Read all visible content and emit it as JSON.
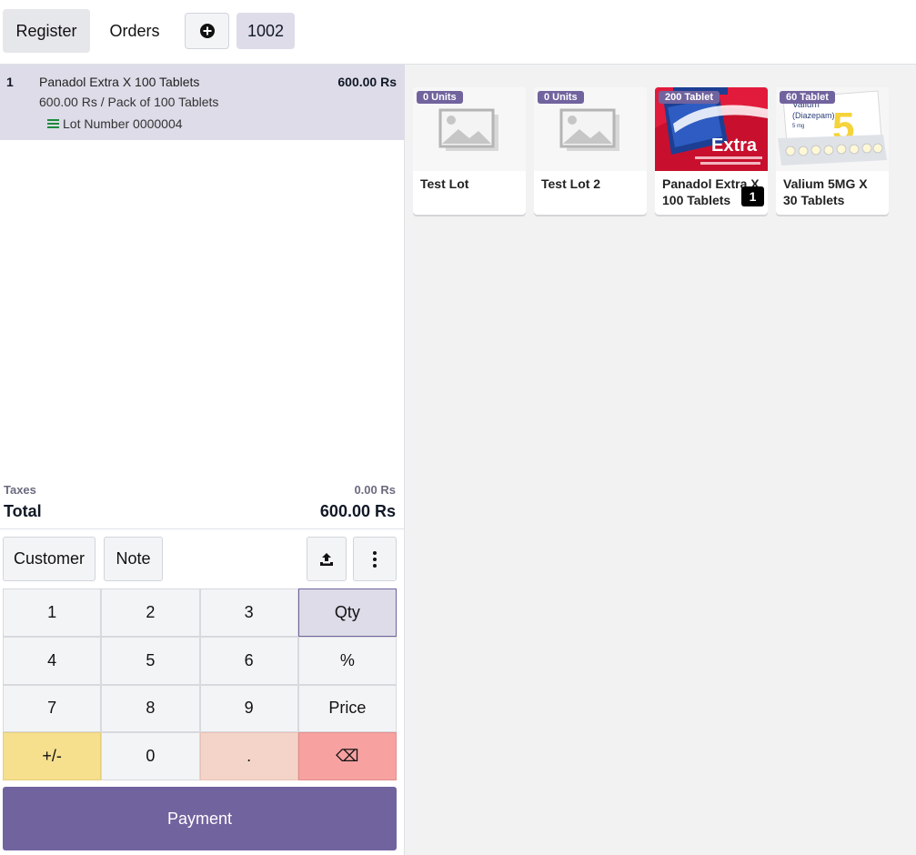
{
  "navbar": {
    "register_label": "Register",
    "orders_label": "Orders",
    "add_order_icon": "plus-circle-icon",
    "order_number": "1002"
  },
  "orderline": {
    "qty": "1",
    "product_name": "Panadol Extra X 100 Tablets",
    "price": "600.00 Rs",
    "unit_info": "600.00 Rs / Pack of 100 Tablets",
    "lot": "Lot Number 0000004"
  },
  "summary": {
    "taxes_label": "Taxes",
    "taxes_value": "0.00 Rs",
    "total_label": "Total",
    "total_value": "600.00 Rs"
  },
  "controls": {
    "customer_label": "Customer",
    "note_label": "Note",
    "upload_icon": "upload-icon",
    "more_icon": "kebab-menu-icon"
  },
  "numpad": {
    "keys": [
      "1",
      "2",
      "3",
      "Qty",
      "4",
      "5",
      "6",
      "%",
      "7",
      "8",
      "9",
      "Price",
      "+/-",
      "0",
      ".",
      "⌫"
    ]
  },
  "payment_label": "Payment",
  "products": [
    {
      "name": "Test Lot",
      "badge": "0 Units",
      "image": "placeholder"
    },
    {
      "name": "Test Lot 2",
      "badge": "0 Units",
      "image": "placeholder"
    },
    {
      "name": "Panadol Extra X 100 Tablets",
      "badge": "200 Tablet",
      "image": "panadol",
      "cart_qty": "1"
    },
    {
      "name": "Valium 5MG X 30 Tablets",
      "badge": "60 Tablet",
      "image": "valium"
    }
  ],
  "colors": {
    "primary": "#71639e",
    "selected_bg": "#dddce8",
    "sign_key": "#f6e08e",
    "dot_key": "#f4d4c9",
    "backspace_key": "#f7a1a1"
  }
}
